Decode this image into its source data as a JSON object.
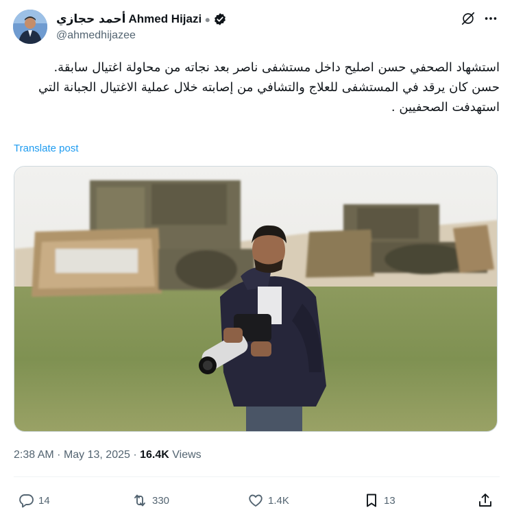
{
  "author": {
    "display_name": "Ahmed Hijazi",
    "display_name_ar": "أحمد حجازي",
    "handle": "@ahmedhijazee",
    "verified": true
  },
  "post": {
    "text": "استشهاد الصحفي حسن اصليح داخل مستشفى ناصر بعد نجاته من محاولة اغتيال سابقة.\nحسن كان يرقد في المستشفى للعلاج والتشافي من إصابته خلال عملية الاغتيال الجبانة التي استهدفت الصحفيين .",
    "translate_label": "Translate post"
  },
  "meta": {
    "time": "2:38 AM",
    "date": "May 13, 2025",
    "views_count": "16.4K",
    "views_label": "Views"
  },
  "actions": {
    "replies": "14",
    "reposts": "330",
    "likes": "1.4K",
    "bookmarks": "13"
  },
  "icons": {
    "verified": "verified-badge-icon",
    "grok": "grok-icon",
    "more": "more-icon",
    "reply": "reply-icon",
    "repost": "repost-icon",
    "like": "like-icon",
    "bookmark": "bookmark-icon",
    "share": "share-icon"
  },
  "colors": {
    "link": "#1d9bf0",
    "secondary_text": "#536471",
    "primary_text": "#0f1419"
  }
}
